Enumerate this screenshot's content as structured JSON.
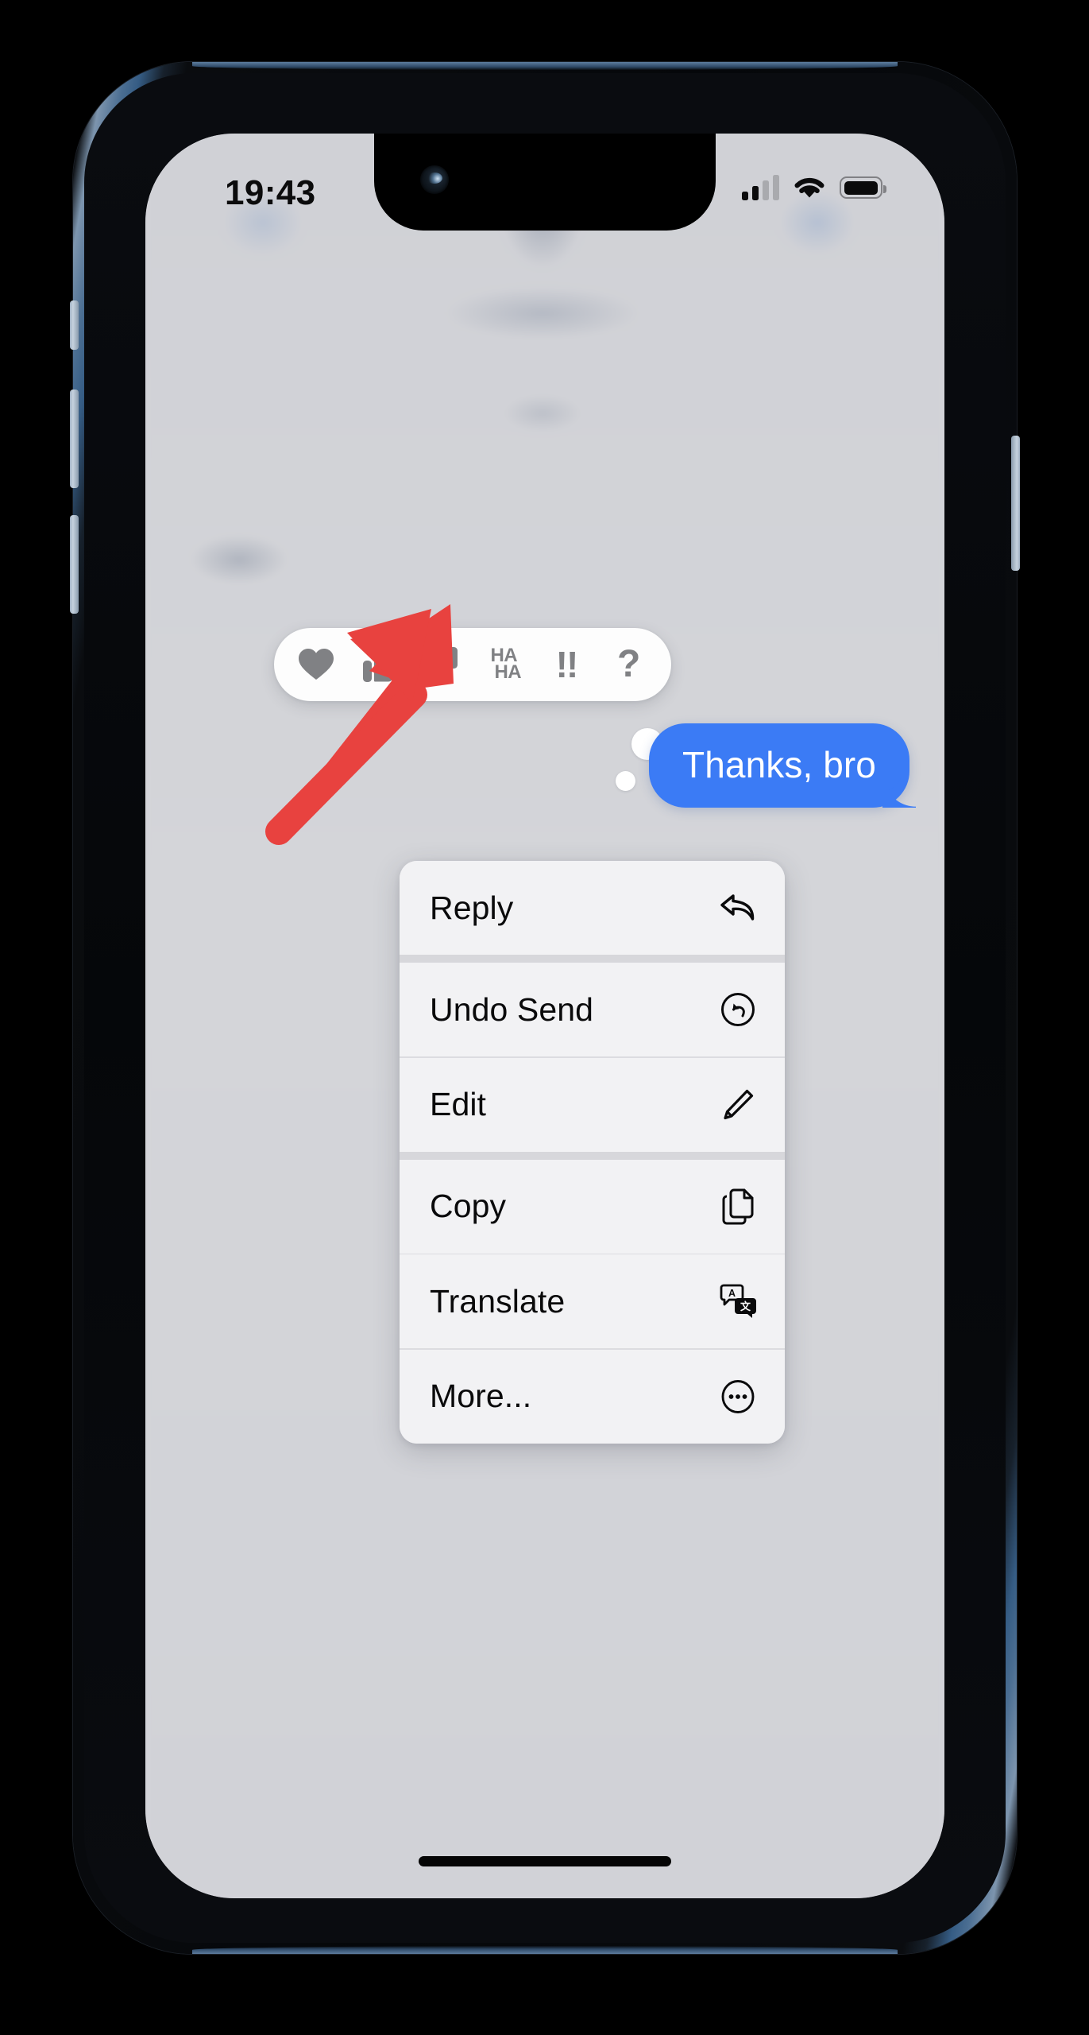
{
  "device": {
    "name": "iphone-13-blue",
    "frame_color": "#3e6188",
    "buttons": [
      "mute-switch",
      "volume-up",
      "volume-down",
      "power"
    ]
  },
  "status_bar": {
    "time": "19:43",
    "signal_icon": "cellular-bars-icon",
    "signal_bars_filled": 2,
    "signal_bars_total": 4,
    "wifi_icon": "wifi-icon",
    "battery_icon": "battery-full-icon",
    "battery_level": "full"
  },
  "conversation": {
    "background_blurred": true,
    "message": {
      "text": "Thanks, bro",
      "sender": "outgoing",
      "bubble_color": "#3b7bf5",
      "text_color": "#ffffff"
    }
  },
  "tapback_bar": {
    "reactions": [
      {
        "name": "heart",
        "label": "Love",
        "icon": "heart-icon"
      },
      {
        "name": "thumbsup",
        "label": "Like",
        "icon": "thumbs-up-icon"
      },
      {
        "name": "thumbsdown",
        "label": "Dislike",
        "icon": "thumbs-down-icon"
      },
      {
        "name": "haha",
        "label": "HA HA",
        "icon": "haha-icon",
        "line1": "HA",
        "line2": "HA"
      },
      {
        "name": "exclamation",
        "label": "!!",
        "icon": "double-exclamation-icon",
        "glyph": "!!"
      },
      {
        "name": "question",
        "label": "?",
        "icon": "question-mark-icon",
        "glyph": "?"
      }
    ],
    "background_color": "#fdfdfd",
    "icon_color": "#808184"
  },
  "context_menu": {
    "background_color": "#f2f2f4",
    "items": [
      {
        "label": "Reply",
        "icon": "reply-arrow-icon"
      },
      {
        "label": "Undo Send",
        "icon": "undo-circle-icon"
      },
      {
        "label": "Edit",
        "icon": "pencil-icon"
      },
      {
        "label": "Copy",
        "icon": "copy-documents-icon"
      },
      {
        "label": "Translate",
        "icon": "translate-bubbles-icon"
      },
      {
        "label": "More...",
        "icon": "ellipsis-circle-icon"
      }
    ]
  },
  "annotation": {
    "type": "arrow",
    "color": "#e8423f",
    "points_to": "Edit",
    "direction": "up-right"
  },
  "home_indicator": {
    "visible": true
  }
}
